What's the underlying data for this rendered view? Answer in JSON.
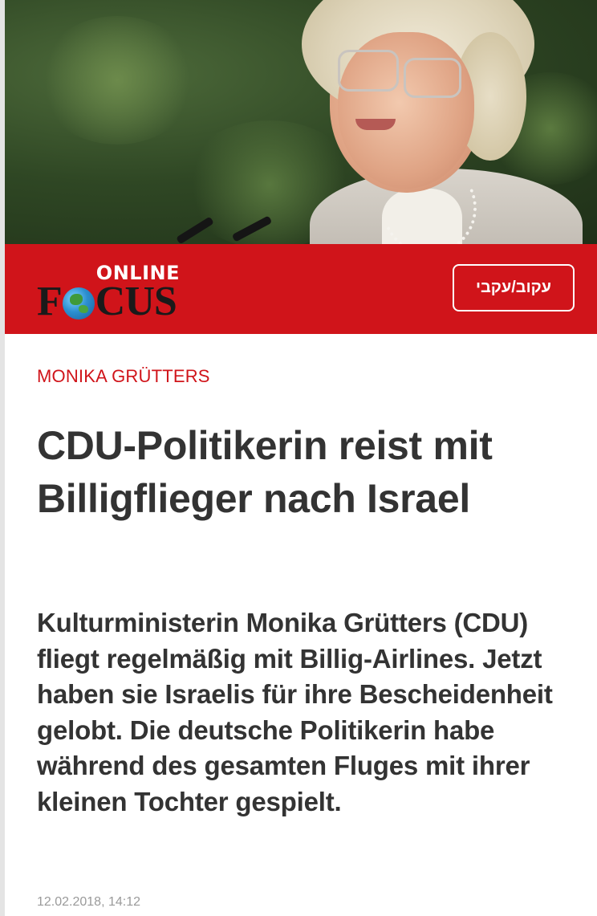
{
  "header": {
    "logo_online": "ONLINE",
    "logo_focus_left": "F",
    "logo_focus_right": "CUS",
    "logo_icon": "globe-icon",
    "follow_label": "עקוב/עקבי",
    "bar_color": "#d0141a"
  },
  "hero_image": {
    "icon": "portrait-photo"
  },
  "article": {
    "kicker": "MONIKA GRÜTTERS",
    "headline": "CDU-Politikerin reist mit Billigflieger nach Israel",
    "teaser": "Kulturministerin Monika Grütters (CDU) fliegt regelmäßig mit Billig-Airlines. Jetzt haben sie Israelis für ihre Bescheidenheit gelobt. Die deutsche Politikerin habe während des gesamten Fluges mit ihrer kleinen Tochter gespielt.",
    "meta_partial": "12.02.2018, 14:12"
  },
  "colors": {
    "accent": "#d0141a",
    "text": "#333333"
  }
}
